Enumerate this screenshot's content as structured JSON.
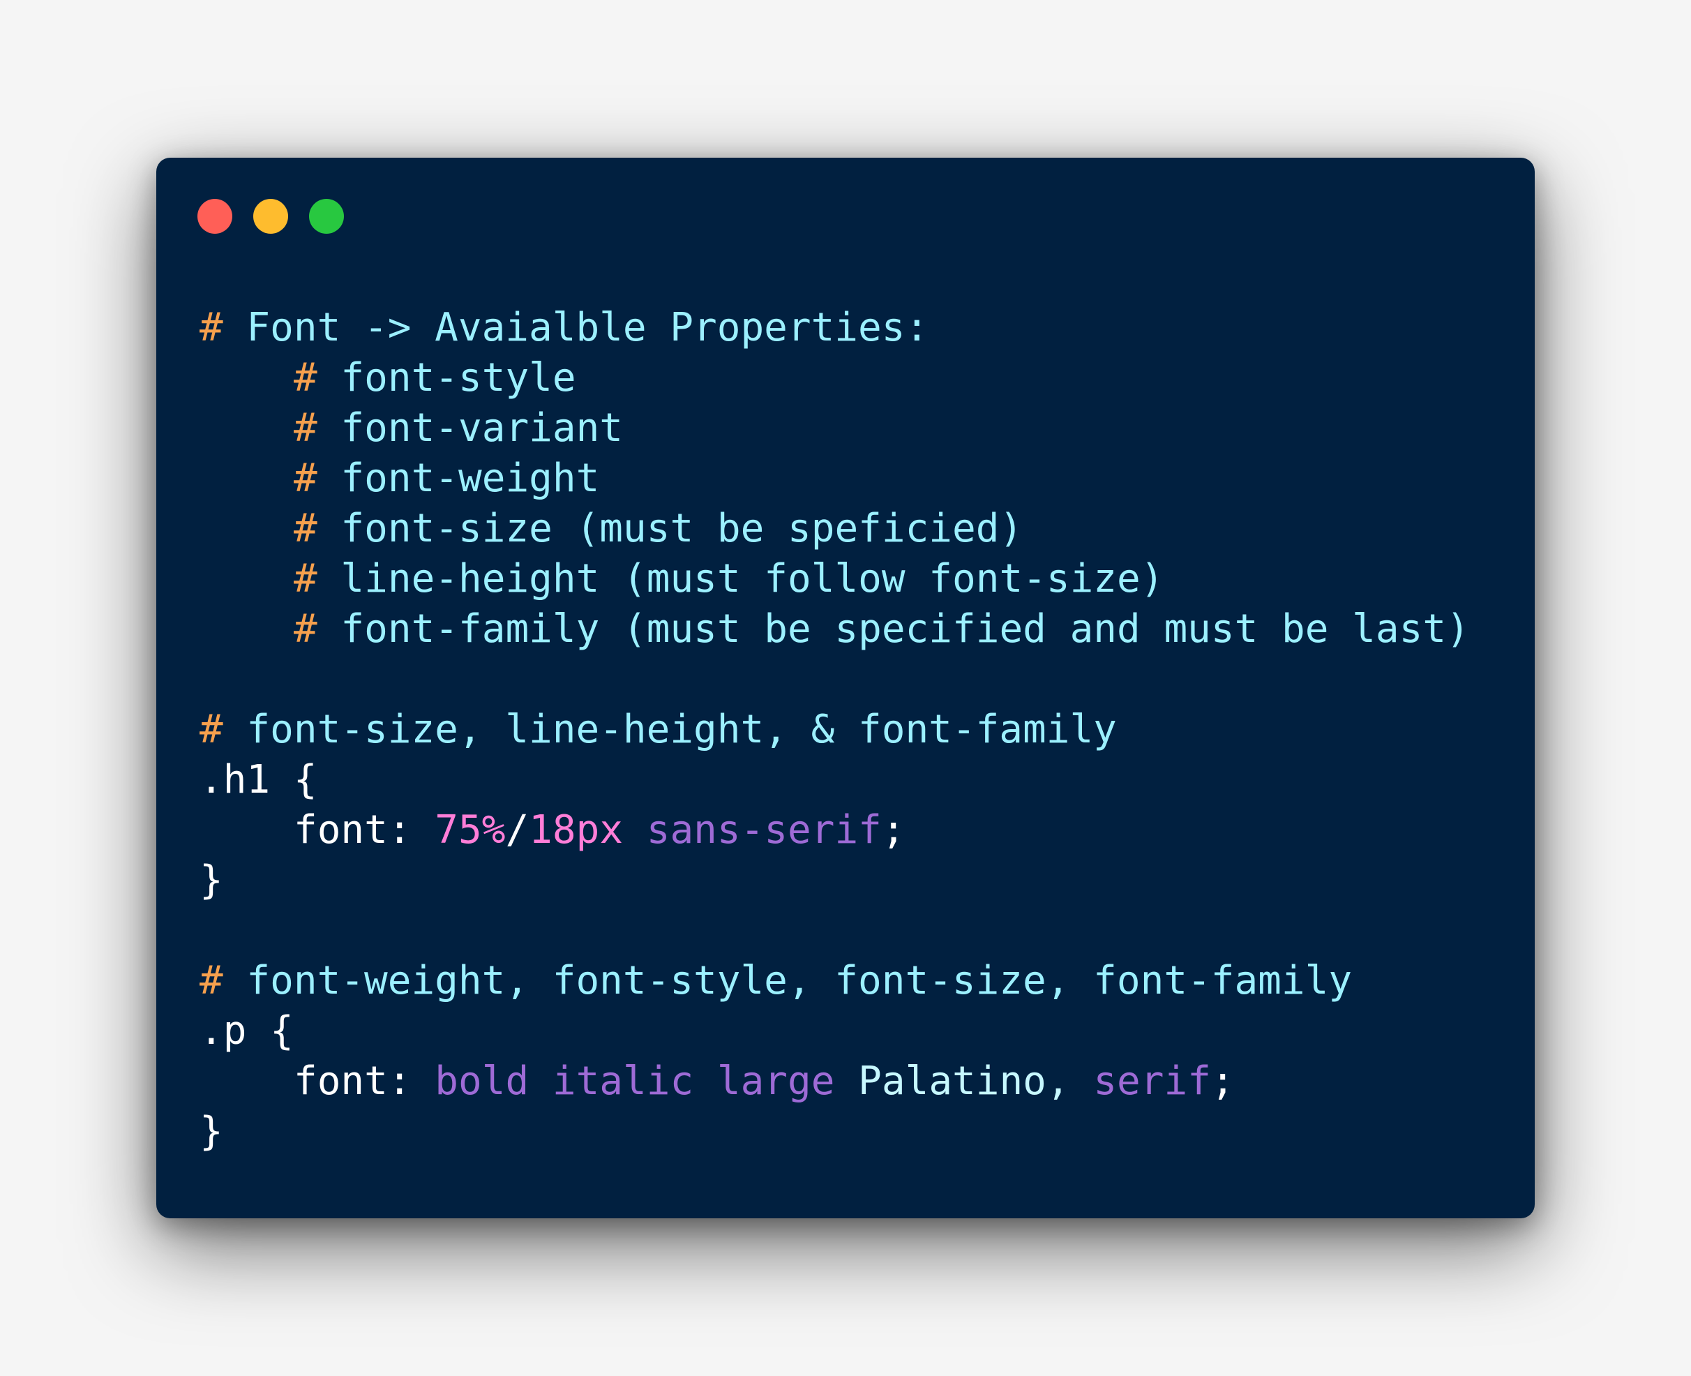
{
  "theme": {
    "background": "#f5f5f5",
    "window_bg": "#012040",
    "dot_red": "#ff5f57",
    "dot_yellow": "#febc2e",
    "dot_green": "#28c840",
    "comment_hash": "#f6a04d",
    "comment_text": "#9cf0ff",
    "plain": "#ffffff",
    "number": "#ff7ed8",
    "keyword": "#9e6bd6",
    "string_font": "#c7f8ff"
  },
  "window_controls": [
    {
      "name": "close-button",
      "color_key": "dot_red"
    },
    {
      "name": "minimize-button",
      "color_key": "dot_yellow"
    },
    {
      "name": "zoom-button",
      "color_key": "dot_green"
    }
  ],
  "code_lines": [
    {
      "indent": false,
      "tokens": [
        {
          "t": "#",
          "c": "comment_hash"
        },
        {
          "t": " Font -> Avaialble Properties:",
          "c": "comment_text"
        }
      ]
    },
    {
      "indent": true,
      "tokens": [
        {
          "t": "#",
          "c": "comment_hash"
        },
        {
          "t": " font-style",
          "c": "comment_text"
        }
      ]
    },
    {
      "indent": true,
      "tokens": [
        {
          "t": "#",
          "c": "comment_hash"
        },
        {
          "t": " font-variant",
          "c": "comment_text"
        }
      ]
    },
    {
      "indent": true,
      "tokens": [
        {
          "t": "#",
          "c": "comment_hash"
        },
        {
          "t": " font-weight",
          "c": "comment_text"
        }
      ]
    },
    {
      "indent": true,
      "tokens": [
        {
          "t": "#",
          "c": "comment_hash"
        },
        {
          "t": " font-size (must be speficied)",
          "c": "comment_text"
        }
      ]
    },
    {
      "indent": true,
      "tokens": [
        {
          "t": "#",
          "c": "comment_hash"
        },
        {
          "t": " line-height (must follow font-size)",
          "c": "comment_text"
        }
      ]
    },
    {
      "indent": true,
      "tokens": [
        {
          "t": "#",
          "c": "comment_hash"
        },
        {
          "t": " font-family (must be specified and must be last)",
          "c": "comment_text"
        }
      ]
    },
    {
      "indent": false,
      "tokens": []
    },
    {
      "indent": false,
      "tokens": [
        {
          "t": "#",
          "c": "comment_hash"
        },
        {
          "t": " font-size, line-height, & font-family",
          "c": "comment_text"
        }
      ]
    },
    {
      "indent": false,
      "tokens": [
        {
          "t": ".h1 {",
          "c": "plain"
        }
      ]
    },
    {
      "indent": true,
      "tokens": [
        {
          "t": "font: ",
          "c": "plain"
        },
        {
          "t": "75%",
          "c": "number"
        },
        {
          "t": "/",
          "c": "plain"
        },
        {
          "t": "18px",
          "c": "number"
        },
        {
          "t": " ",
          "c": "plain"
        },
        {
          "t": "sans-serif",
          "c": "keyword"
        },
        {
          "t": ";",
          "c": "plain"
        }
      ]
    },
    {
      "indent": false,
      "tokens": [
        {
          "t": "}",
          "c": "plain"
        }
      ]
    },
    {
      "indent": false,
      "tokens": []
    },
    {
      "indent": false,
      "tokens": [
        {
          "t": "#",
          "c": "comment_hash"
        },
        {
          "t": " font-weight, font-style, font-size, font-family",
          "c": "comment_text"
        }
      ]
    },
    {
      "indent": false,
      "tokens": [
        {
          "t": ".p {",
          "c": "plain"
        }
      ]
    },
    {
      "indent": true,
      "tokens": [
        {
          "t": "font: ",
          "c": "plain"
        },
        {
          "t": "bold italic large",
          "c": "keyword"
        },
        {
          "t": " Palatino, ",
          "c": "string_font"
        },
        {
          "t": "serif",
          "c": "keyword"
        },
        {
          "t": ";",
          "c": "plain"
        }
      ]
    },
    {
      "indent": false,
      "tokens": [
        {
          "t": "}",
          "c": "plain"
        }
      ]
    }
  ]
}
